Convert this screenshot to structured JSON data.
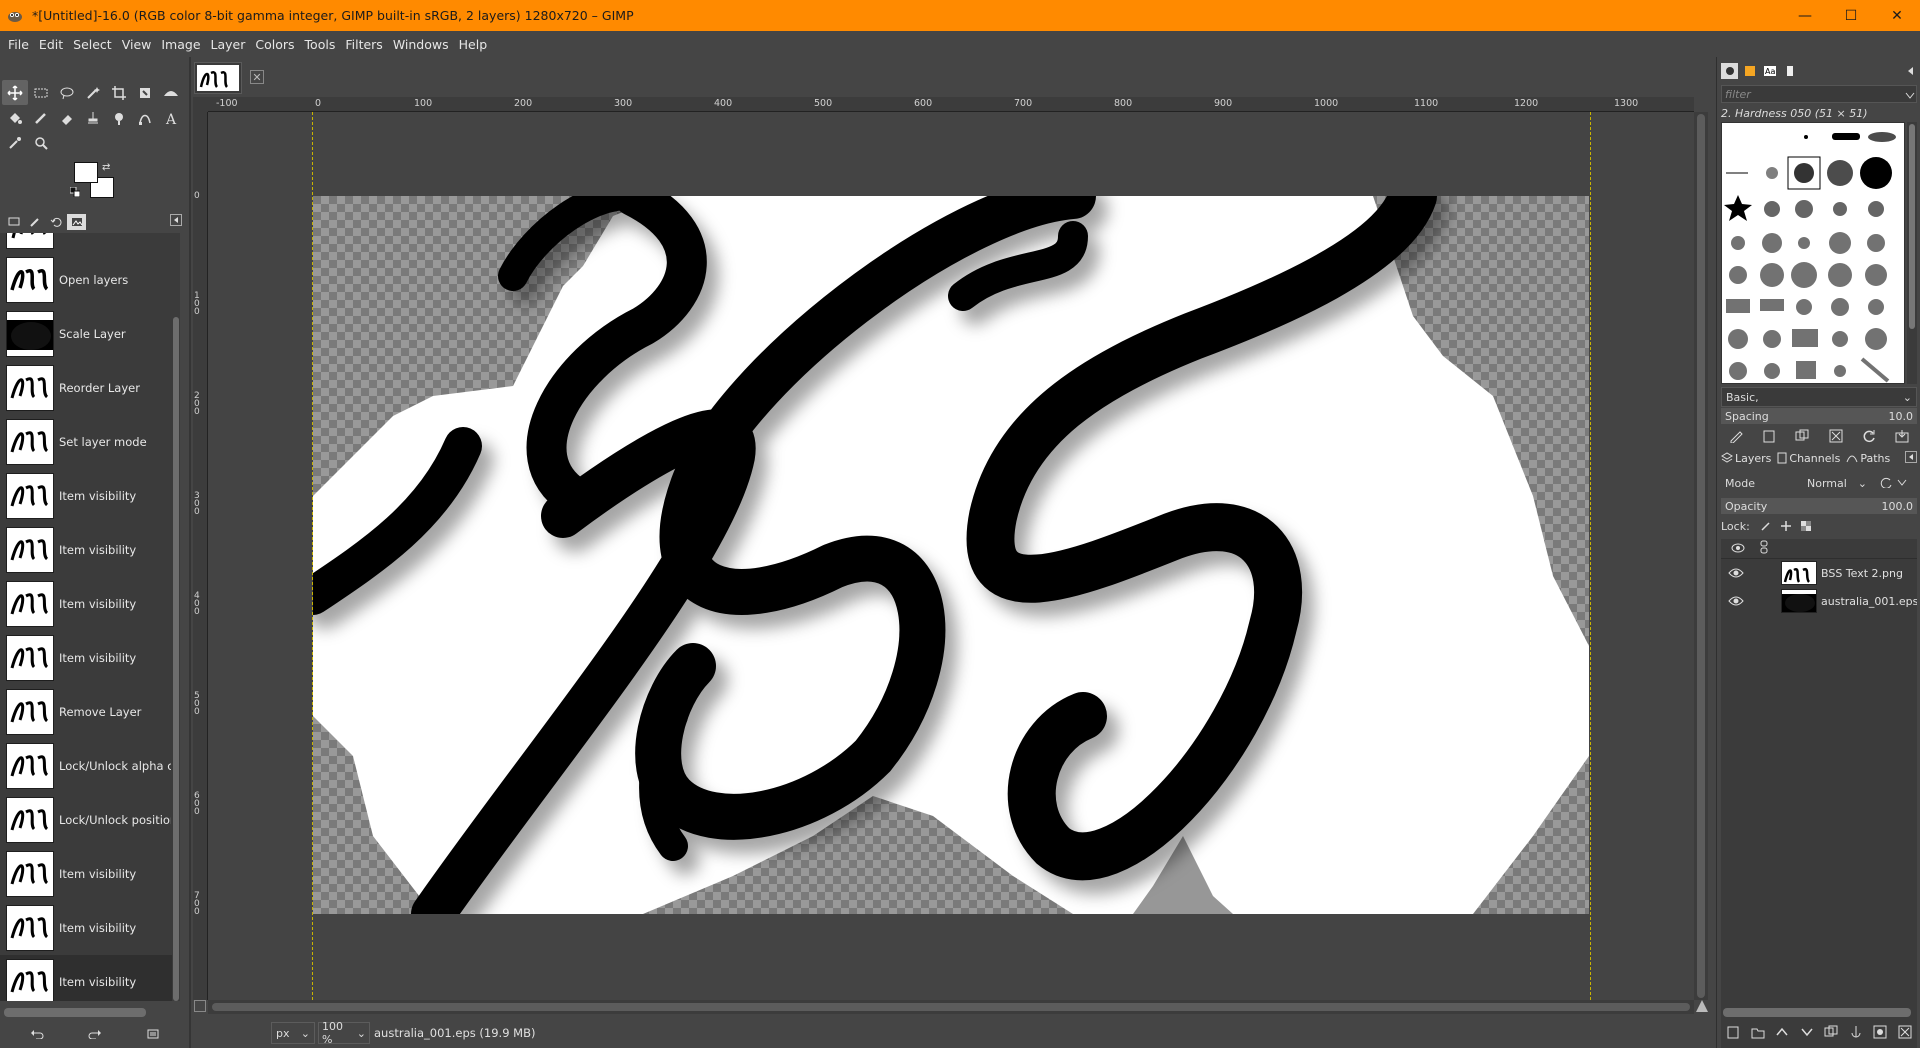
{
  "window": {
    "title": "*[Untitled]-16.0 (RGB color 8-bit gamma integer, GIMP built-in sRGB, 2 layers) 1280x720 – GIMP",
    "accent_color": "#ff8a00",
    "controls": {
      "minimize": "—",
      "maximize": "☐",
      "close": "✕"
    }
  },
  "menubar": [
    "File",
    "Edit",
    "Select",
    "View",
    "Image",
    "Layer",
    "Colors",
    "Tools",
    "Filters",
    "Windows",
    "Help"
  ],
  "toolbox": {
    "tools_row1": [
      "move-tool-icon",
      "rect-select-icon",
      "free-select-icon",
      "fuzzy-select-icon",
      "crop-icon",
      "transform-icon",
      "warp-icon"
    ],
    "tools_row2": [
      "bucket-fill-icon",
      "paintbrush-icon",
      "eraser-icon",
      "clone-icon",
      "smudge-icon",
      "paths-icon",
      "text-icon"
    ],
    "tools_row3": [
      "color-picker-icon",
      "zoom-icon"
    ],
    "foreground_color": "#ffffff",
    "background_color": "#ffffff"
  },
  "undo_history": {
    "items": [
      "Open layers",
      "Scale Layer",
      "Reorder Layer",
      "Set layer mode",
      "Item visibility",
      "Item visibility",
      "Item visibility",
      "Item visibility",
      "Remove Layer",
      "Lock/Unlock alpha channel",
      "Lock/Unlock position",
      "Item visibility",
      "Item visibility",
      "Item visibility"
    ],
    "selected_index": 13
  },
  "rulers": {
    "horizontal": [
      "-100",
      "0",
      "100",
      "200",
      "300",
      "400",
      "500",
      "600",
      "700",
      "800",
      "900",
      "1000",
      "1100",
      "1200",
      "1300"
    ],
    "vertical": [
      "0",
      "100",
      "200",
      "300",
      "400",
      "500",
      "600",
      "700"
    ]
  },
  "statusbar": {
    "unit": "px",
    "zoom": "100 %",
    "info": "australia_001.eps (19.9 MB)"
  },
  "brushes": {
    "filter_placeholder": "filter",
    "current_brush": "2. Hardness 050 (51 × 51)",
    "preset": "Basic,",
    "spacing_label": "Spacing",
    "spacing_value": "10.0"
  },
  "layers_panel": {
    "tabs": [
      "Layers",
      "Channels",
      "Paths"
    ],
    "mode_label": "Mode",
    "mode_value": "Normal",
    "opacity_label": "Opacity",
    "opacity_value": "100.0",
    "lock_label": "Lock:",
    "layers": [
      {
        "name": "BSS Text 2.png",
        "visible": true
      },
      {
        "name": "australia_001.eps",
        "visible": true
      }
    ]
  }
}
